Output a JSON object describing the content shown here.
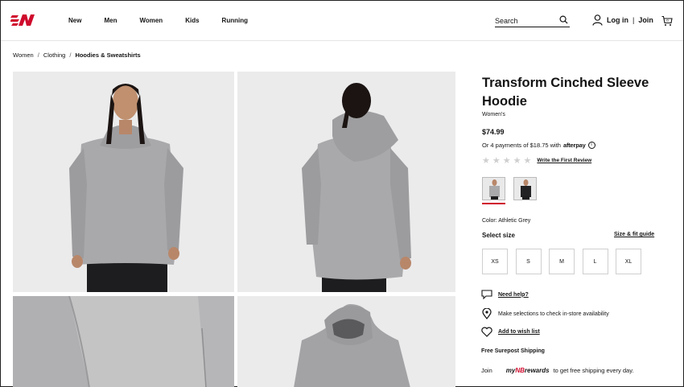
{
  "header": {
    "nav": [
      "New",
      "Men",
      "Women",
      "Kids",
      "Running"
    ],
    "search_label": "Search",
    "login": "Log in",
    "separator": "|",
    "join": "Join"
  },
  "breadcrumb": {
    "items": [
      "Women",
      "Clothing"
    ],
    "current": "Hoodies & Sweatshirts"
  },
  "product": {
    "title": "Transform Cinched Sleeve Hoodie",
    "gender": "Women's",
    "price": "$74.99",
    "afterpay_text": "Or 4 payments of $18.75 with",
    "afterpay_brand": "afterpay",
    "rating_stars": 5,
    "review_link": "Write the First Review",
    "color_label": "Color: Athletic Grey",
    "select_size": "Select size",
    "size_guide": "Size & fit guide",
    "sizes": [
      "XS",
      "S",
      "M",
      "L",
      "XL"
    ],
    "need_help": "Need help?",
    "store_text": "Make selections to check in-store availability",
    "wishlist": "Add to wish list",
    "shipping": "Free Surepost Shipping",
    "rewards_prefix": "Join",
    "rewards_my": "my",
    "rewards_mark": "NB",
    "rewards_word": "rewards",
    "rewards_suffix": "to get free shipping every day."
  },
  "colors": {
    "brand_red": "#cf0a2c",
    "text": "#151415",
    "photo_bg": "#ebebec",
    "hoodie_grey": "#a9a9ab"
  }
}
